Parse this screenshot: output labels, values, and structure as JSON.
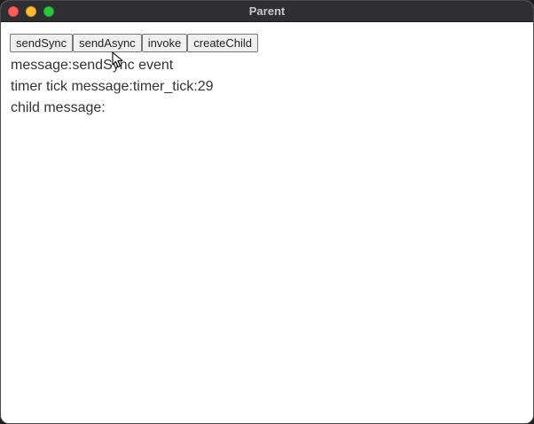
{
  "window": {
    "title": "Parent"
  },
  "toolbar": {
    "buttons": [
      {
        "label": "sendSync"
      },
      {
        "label": "sendAsync"
      },
      {
        "label": "invoke"
      },
      {
        "label": "createChild"
      }
    ]
  },
  "messages": {
    "message_line": "message:sendSync event",
    "timer_line": "timer tick message:timer_tick:29",
    "child_line": "child message:"
  },
  "colors": {
    "titlebar": "#2f2e33",
    "close": "#ff5f57",
    "minimize": "#febc2e",
    "zoom": "#28c840"
  },
  "icons": {
    "cursor": "mouse-pointer-icon"
  }
}
